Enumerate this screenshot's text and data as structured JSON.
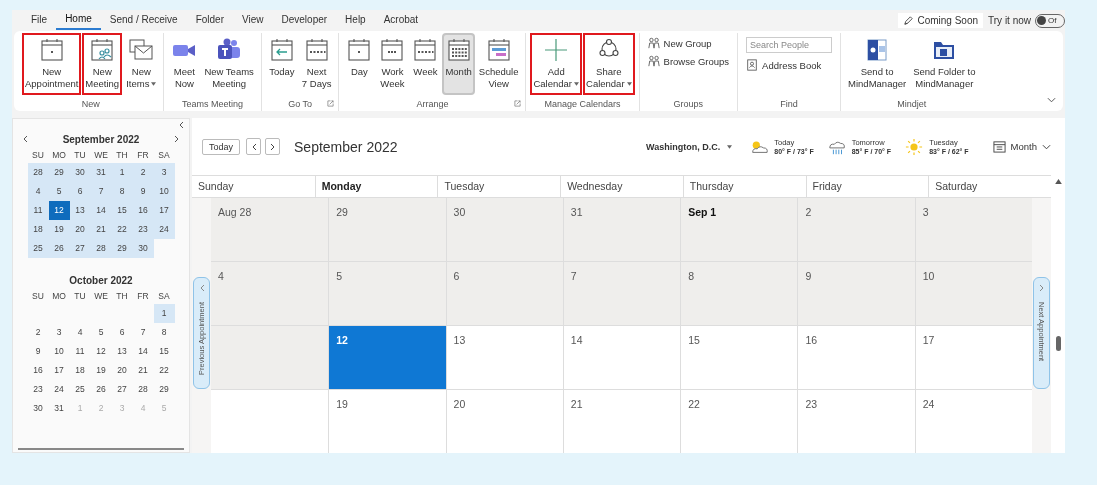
{
  "tabs": [
    {
      "label": "File",
      "selected": false
    },
    {
      "label": "Home",
      "selected": true
    },
    {
      "label": "Send / Receive",
      "selected": false
    },
    {
      "label": "Folder",
      "selected": false
    },
    {
      "label": "View",
      "selected": false
    },
    {
      "label": "Developer",
      "selected": false
    },
    {
      "label": "Help",
      "selected": false
    },
    {
      "label": "Acrobat",
      "selected": false
    }
  ],
  "coming_soon": {
    "label": "Coming Soon"
  },
  "try_it": {
    "label": "Try it now",
    "toggle_text": "Of",
    "on": false
  },
  "ribbon_groups": [
    {
      "label": "New",
      "buttons": [
        {
          "lines": [
            "New",
            "Appointment"
          ],
          "kind": "cal-dot",
          "highlighted": true,
          "selected": false
        },
        {
          "lines": [
            "New",
            "Meeting"
          ],
          "kind": "cal-people",
          "highlighted": true,
          "selected": false
        },
        {
          "lines": [
            "New",
            "Items"
          ],
          "kind": "envelope",
          "highlighted": false,
          "selected": false,
          "dropdown": true
        }
      ]
    },
    {
      "label": "Teams Meeting",
      "buttons": [
        {
          "lines": [
            "Meet",
            "Now"
          ],
          "kind": "video",
          "highlighted": false,
          "selected": false
        },
        {
          "lines": [
            "New Teams",
            "Meeting"
          ],
          "kind": "teams",
          "highlighted": false,
          "selected": false
        }
      ]
    },
    {
      "label": "Go To",
      "launcher": true,
      "buttons": [
        {
          "lines": [
            "Today"
          ],
          "kind": "cal-arrow",
          "highlighted": false,
          "selected": false
        },
        {
          "lines": [
            "Next",
            "7 Days"
          ],
          "kind": "cal-week",
          "highlighted": false,
          "selected": false
        }
      ]
    },
    {
      "label": "Arrange",
      "launcher": true,
      "buttons": [
        {
          "lines": [
            "Day"
          ],
          "kind": "cal-dot",
          "highlighted": false,
          "selected": false
        },
        {
          "lines": [
            "Work",
            "Week"
          ],
          "kind": "cal-dots",
          "highlighted": false,
          "selected": false
        },
        {
          "lines": [
            "Week"
          ],
          "kind": "cal-week",
          "highlighted": false,
          "selected": false
        },
        {
          "lines": [
            "Month"
          ],
          "kind": "cal-month",
          "highlighted": false,
          "selected": true
        },
        {
          "lines": [
            "Schedule",
            "View"
          ],
          "kind": "cal-schedule",
          "highlighted": false,
          "selected": false
        }
      ]
    },
    {
      "label": "Manage Calendars",
      "buttons": [
        {
          "lines": [
            "Add",
            "Calendar"
          ],
          "kind": "plus",
          "highlighted": true,
          "selected": false,
          "dropdown": true
        },
        {
          "lines": [
            "Share",
            "Calendar"
          ],
          "kind": "share",
          "highlighted": true,
          "selected": false,
          "dropdown": true
        }
      ]
    },
    {
      "label": "Groups",
      "small": [
        {
          "label": "New Group",
          "kind": "people"
        },
        {
          "label": "Browse Groups",
          "kind": "people"
        }
      ]
    },
    {
      "label": "Find",
      "search": {
        "placeholder": "Search People"
      },
      "small": [
        {
          "label": "Address Book",
          "kind": "book"
        }
      ]
    },
    {
      "label": "Mindjet",
      "buttons": [
        {
          "lines": [
            "Send to",
            "MindManager"
          ],
          "kind": "mindmanager",
          "highlighted": false,
          "selected": false
        },
        {
          "lines": [
            "Send Folder to",
            "MindManager"
          ],
          "kind": "folder",
          "highlighted": false,
          "selected": false
        }
      ]
    }
  ],
  "mini_months": [
    {
      "title": "September 2022",
      "nav": true,
      "weekdays": [
        "SU",
        "MO",
        "TU",
        "WE",
        "TH",
        "FR",
        "SA"
      ],
      "weeks": [
        [
          {
            "label": "28",
            "in_view": true,
            "selected": false,
            "other_month": false
          },
          {
            "label": "29",
            "in_view": true,
            "selected": false,
            "other_month": false
          },
          {
            "label": "30",
            "in_view": true,
            "selected": false,
            "other_month": false
          },
          {
            "label": "31",
            "in_view": true,
            "selected": false,
            "other_month": false
          },
          {
            "label": "1",
            "in_view": true,
            "selected": false,
            "other_month": false
          },
          {
            "label": "2",
            "in_view": true,
            "selected": false,
            "other_month": false
          },
          {
            "label": "3",
            "in_view": true,
            "selected": false,
            "other_month": false
          }
        ],
        [
          {
            "label": "4",
            "in_view": true,
            "selected": false,
            "other_month": false
          },
          {
            "label": "5",
            "in_view": true,
            "selected": false,
            "other_month": false
          },
          {
            "label": "6",
            "in_view": true,
            "selected": false,
            "other_month": false
          },
          {
            "label": "7",
            "in_view": true,
            "selected": false,
            "other_month": false
          },
          {
            "label": "8",
            "in_view": true,
            "selected": false,
            "other_month": false
          },
          {
            "label": "9",
            "in_view": true,
            "selected": false,
            "other_month": false
          },
          {
            "label": "10",
            "in_view": true,
            "selected": false,
            "other_month": false
          }
        ],
        [
          {
            "label": "11",
            "in_view": true,
            "selected": false,
            "other_month": false
          },
          {
            "label": "12",
            "in_view": true,
            "selected": true,
            "other_month": false
          },
          {
            "label": "13",
            "in_view": true,
            "selected": false,
            "other_month": false
          },
          {
            "label": "14",
            "in_view": true,
            "selected": false,
            "other_month": false
          },
          {
            "label": "15",
            "in_view": true,
            "selected": false,
            "other_month": false
          },
          {
            "label": "16",
            "in_view": true,
            "selected": false,
            "other_month": false
          },
          {
            "label": "17",
            "in_view": true,
            "selected": false,
            "other_month": false
          }
        ],
        [
          {
            "label": "18",
            "in_view": true,
            "selected": false,
            "other_month": false
          },
          {
            "label": "19",
            "in_view": true,
            "selected": false,
            "other_month": false
          },
          {
            "label": "20",
            "in_view": true,
            "selected": false,
            "other_month": false
          },
          {
            "label": "21",
            "in_view": true,
            "selected": false,
            "other_month": false
          },
          {
            "label": "22",
            "in_view": true,
            "selected": false,
            "other_month": false
          },
          {
            "label": "23",
            "in_view": true,
            "selected": false,
            "other_month": false
          },
          {
            "label": "24",
            "in_view": true,
            "selected": false,
            "other_month": false
          }
        ],
        [
          {
            "label": "25",
            "in_view": true,
            "selected": false,
            "other_month": false
          },
          {
            "label": "26",
            "in_view": true,
            "selected": false,
            "other_month": false
          },
          {
            "label": "27",
            "in_view": true,
            "selected": false,
            "other_month": false
          },
          {
            "label": "28",
            "in_view": true,
            "selected": false,
            "other_month": false
          },
          {
            "label": "29",
            "in_view": true,
            "selected": false,
            "other_month": false
          },
          {
            "label": "30",
            "in_view": true,
            "selected": false,
            "other_month": false
          }
        ]
      ]
    },
    {
      "title": "October 2022",
      "weekdays": [
        "SU",
        "MO",
        "TU",
        "WE",
        "TH",
        "FR",
        "SA"
      ],
      "weeks": [
        [
          {
            "label": "1",
            "in_view": true,
            "selected": false,
            "other_month": false
          }
        ],
        [
          {
            "label": "2",
            "in_view": false,
            "selected": false,
            "other_month": false
          },
          {
            "label": "3",
            "in_view": false,
            "selected": false,
            "other_month": false
          },
          {
            "label": "4",
            "in_view": false,
            "selected": false,
            "other_month": false
          },
          {
            "label": "5",
            "in_view": false,
            "selected": false,
            "other_month": false
          },
          {
            "label": "6",
            "in_view": false,
            "selected": false,
            "other_month": false
          },
          {
            "label": "7",
            "in_view": false,
            "selected": false,
            "other_month": false
          },
          {
            "label": "8",
            "in_view": false,
            "selected": false,
            "other_month": false
          }
        ],
        [
          {
            "label": "9",
            "in_view": false,
            "selected": false,
            "other_month": false
          },
          {
            "label": "10",
            "in_view": false,
            "selected": false,
            "other_month": false
          },
          {
            "label": "11",
            "in_view": false,
            "selected": false,
            "other_month": false
          },
          {
            "label": "12",
            "in_view": false,
            "selected": false,
            "other_month": false
          },
          {
            "label": "13",
            "in_view": false,
            "selected": false,
            "other_month": false
          },
          {
            "label": "14",
            "in_view": false,
            "selected": false,
            "other_month": false
          },
          {
            "label": "15",
            "in_view": false,
            "selected": false,
            "other_month": false
          }
        ],
        [
          {
            "label": "16",
            "in_view": false,
            "selected": false,
            "other_month": false
          },
          {
            "label": "17",
            "in_view": false,
            "selected": false,
            "other_month": false
          },
          {
            "label": "18",
            "in_view": false,
            "selected": false,
            "other_month": false
          },
          {
            "label": "19",
            "in_view": false,
            "selected": false,
            "other_month": false
          },
          {
            "label": "20",
            "in_view": false,
            "selected": false,
            "other_month": false
          },
          {
            "label": "21",
            "in_view": false,
            "selected": false,
            "other_month": false
          },
          {
            "label": "22",
            "in_view": false,
            "selected": false,
            "other_month": false
          }
        ],
        [
          {
            "label": "23",
            "in_view": false,
            "selected": false,
            "other_month": false
          },
          {
            "label": "24",
            "in_view": false,
            "selected": false,
            "other_month": false
          },
          {
            "label": "25",
            "in_view": false,
            "selected": false,
            "other_month": false
          },
          {
            "label": "26",
            "in_view": false,
            "selected": false,
            "other_month": false
          },
          {
            "label": "27",
            "in_view": false,
            "selected": false,
            "other_month": false
          },
          {
            "label": "28",
            "in_view": false,
            "selected": false,
            "other_month": false
          },
          {
            "label": "29",
            "in_view": false,
            "selected": false,
            "other_month": false
          }
        ],
        [
          {
            "label": "30",
            "in_view": false,
            "selected": false,
            "other_month": false
          },
          {
            "label": "31",
            "in_view": false,
            "selected": false,
            "other_month": false
          },
          {
            "label": "1",
            "in_view": false,
            "selected": false,
            "other_month": true
          },
          {
            "label": "2",
            "in_view": false,
            "selected": false,
            "other_month": true
          },
          {
            "label": "3",
            "in_view": false,
            "selected": false,
            "other_month": true
          },
          {
            "label": "4",
            "in_view": false,
            "selected": false,
            "other_month": true
          },
          {
            "label": "5",
            "in_view": false,
            "selected": false,
            "other_month": true
          }
        ]
      ]
    }
  ],
  "calendar": {
    "today_button": "Today",
    "title": "September 2022",
    "location": "Washington, D.C.",
    "weather": [
      {
        "day": "Today",
        "temps": "80° F / 73° F",
        "kind": "sun-cloud"
      },
      {
        "day": "Tomorrow",
        "temps": "85° F / 70° F",
        "kind": "rain"
      },
      {
        "day": "Tuesday",
        "temps": "83° F / 62° F",
        "kind": "sun"
      }
    ],
    "view": "Month",
    "weekdays": [
      {
        "label": "Sunday",
        "current": false
      },
      {
        "label": "Monday",
        "current": true
      },
      {
        "label": "Tuesday",
        "current": false
      },
      {
        "label": "Wednesday",
        "current": false
      },
      {
        "label": "Thursday",
        "current": false
      },
      {
        "label": "Friday",
        "current": false
      },
      {
        "label": "Saturday",
        "current": false
      }
    ],
    "weeks": [
      [
        {
          "label": "Aug 28",
          "past": true,
          "selected": false,
          "bold": false
        },
        {
          "label": "29",
          "past": true,
          "selected": false,
          "bold": false
        },
        {
          "label": "30",
          "past": true,
          "selected": false,
          "bold": false
        },
        {
          "label": "31",
          "past": true,
          "selected": false,
          "bold": false
        },
        {
          "label": "Sep 1",
          "past": true,
          "selected": false,
          "bold": true
        },
        {
          "label": "2",
          "past": true,
          "selected": false,
          "bold": false
        },
        {
          "label": "3",
          "past": true,
          "selected": false,
          "bold": false
        }
      ],
      [
        {
          "label": "4",
          "past": true,
          "selected": false,
          "bold": false
        },
        {
          "label": "5",
          "past": true,
          "selected": false,
          "bold": false
        },
        {
          "label": "6",
          "past": true,
          "selected": false,
          "bold": false
        },
        {
          "label": "7",
          "past": true,
          "selected": false,
          "bold": false
        },
        {
          "label": "8",
          "past": true,
          "selected": false,
          "bold": false
        },
        {
          "label": "9",
          "past": true,
          "selected": false,
          "bold": false
        },
        {
          "label": "10",
          "past": true,
          "selected": false,
          "bold": false
        }
      ],
      [
        {
          "past": true,
          "selected": false
        },
        {
          "label": "12",
          "past": false,
          "selected": true,
          "bold": true
        },
        {
          "label": "13",
          "past": false,
          "selected": false,
          "bold": false
        },
        {
          "label": "14",
          "past": false,
          "selected": false,
          "bold": false
        },
        {
          "label": "15",
          "past": false,
          "selected": false,
          "bold": false
        },
        {
          "label": "16",
          "past": false,
          "selected": false,
          "bold": false
        },
        {
          "label": "17",
          "past": false,
          "selected": false,
          "bold": false
        }
      ],
      [
        {
          "past": false,
          "selected": false
        },
        {
          "label": "19",
          "past": false,
          "selected": false,
          "bold": false
        },
        {
          "label": "20",
          "past": false,
          "selected": false,
          "bold": false
        },
        {
          "label": "21",
          "past": false,
          "selected": false,
          "bold": false
        },
        {
          "label": "22",
          "past": false,
          "selected": false,
          "bold": false
        },
        {
          "label": "23",
          "past": false,
          "selected": false,
          "bold": false
        },
        {
          "label": "24",
          "past": false,
          "selected": false,
          "bold": false
        }
      ]
    ],
    "previous_tab": "Previous Appointment",
    "next_tab": "Next Appointment"
  }
}
